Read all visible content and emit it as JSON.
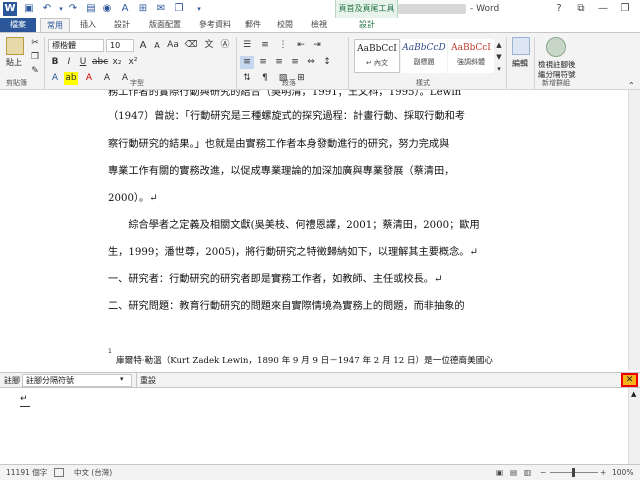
{
  "title": {
    "doc_name": "- Word",
    "context_tab": "頁首及頁尾工具"
  },
  "tabs": [
    "檔案",
    "常用",
    "插入",
    "設計",
    "版面配置",
    "參考資料",
    "郵件",
    "校閱",
    "檢視",
    "設計"
  ],
  "home": {
    "clipboard": {
      "paste": "貼上",
      "label": "剪貼簿"
    },
    "font": {
      "name": "標楷體",
      "size": "10",
      "label": "字型",
      "size_small": "A",
      "size_large": "A"
    },
    "paragraph": {
      "label": "段落"
    },
    "styles": {
      "label": "樣式",
      "items": [
        {
          "sample": "AaBbCcI",
          "name": "↵ 內文",
          "color": "#000000"
        },
        {
          "sample": "AaBbCcD",
          "name": "副標題",
          "color": "#2f4a85"
        },
        {
          "sample": "AaBbCcI",
          "name": "強調斜體",
          "color": "#c0392b"
        }
      ]
    },
    "editing": {
      "label": "編輯"
    },
    "addins": {
      "line1": "檢視註腳後",
      "line2": "繼分隔符號",
      "label": "新增群組"
    }
  },
  "document": {
    "lines": [
      "務工作者的實際行動與研究的結合（吳明清，1991；王文科，1995）。Lewin",
      "（1947）曾說：「行動研究是三種螺旋式的探究過程：計畫行動、採取行動和考",
      "察行動研究的結果。」也就是由實務工作者本身發動進行的研究，努力完成與",
      "專業工作有關的實務改進，以促成專業理論的加深加廣與專業發展（蔡清田，",
      "2000）。↵",
      "　　綜合學者之定義及相關文獻(吳美枝、何禮恩譯，2001；蔡清田，2000；歐用",
      "生，1999；潘世尊，2005)，將行動研究之特徵歸納如下，以理解其主要概念。↵",
      "一、研究者：行動研究的研究者即是實務工作者，如教師、主任或校長。↵",
      "二、研究問題：教育行動研究的問題來自實際情境為實務上的問題，而非抽象的"
    ],
    "footnote": "庫爾特·勒溫（Kurt Zadek Lewin，1890 年 9 月 9 日－1947 年 2 月 12 日）是一位德裔美國心",
    "footnote_marker": "1"
  },
  "footnote_pane": {
    "label": "註腳",
    "select_value": "註腳分隔符號",
    "reset": "重設",
    "close": "✕",
    "content": "↵"
  },
  "status": {
    "words": "11191 個字",
    "language": "中文 (台灣)",
    "zoom": "100%",
    "zoom_out": "−",
    "zoom_in": "+"
  },
  "colors": {
    "accent": "#2b579a",
    "context": "#217346",
    "highlight": "#e00000"
  }
}
